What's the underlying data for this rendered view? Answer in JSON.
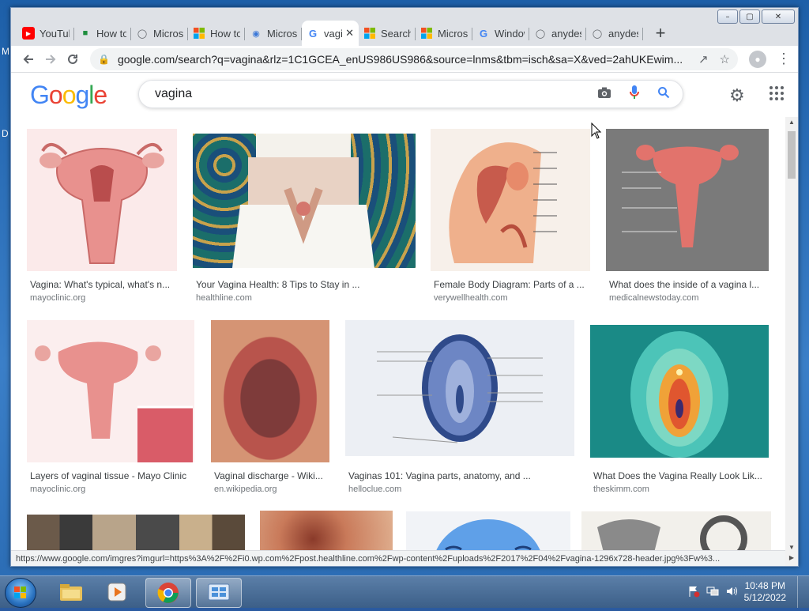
{
  "desktop": {
    "marks": [
      "M",
      "D"
    ]
  },
  "window": {
    "min_glyph": "–",
    "max_glyph": "▢",
    "close_glyph": "✕"
  },
  "tabs": [
    {
      "title": "YouTube",
      "icon": "youtube-icon",
      "color": "#ff0000"
    },
    {
      "title": "How to",
      "icon": "doc-person-icon",
      "color": "#1e8e3e"
    },
    {
      "title": "Microsoft",
      "icon": "globe-icon",
      "color": "#5f6368"
    },
    {
      "title": "How to",
      "icon": "microsoft-icon",
      "color": "#f25022"
    },
    {
      "title": "Microsoft",
      "icon": "edge-globe-icon",
      "color": "#3b78d8"
    },
    {
      "title": "vagina",
      "icon": "google-g-icon",
      "color": "#4285f4",
      "active": true
    },
    {
      "title": "Search",
      "icon": "microsoft-icon",
      "color": "#f25022"
    },
    {
      "title": "Microsoft",
      "icon": "microsoft-icon",
      "color": "#f25022"
    },
    {
      "title": "Windows",
      "icon": "google-g-icon",
      "color": "#4285f4"
    },
    {
      "title": "anydesk",
      "icon": "globe-icon",
      "color": "#5f6368"
    },
    {
      "title": "anydesk",
      "icon": "globe-icon",
      "color": "#5f6368"
    }
  ],
  "toolbar": {
    "url": "google.com/search?q=vagina&rlz=1C1GCEA_enUS986US986&source=lnms&tbm=isch&sa=X&ved=2ahUKEwim..."
  },
  "google": {
    "logo_letters": [
      {
        "ch": "G",
        "color": "#4285f4"
      },
      {
        "ch": "o",
        "color": "#ea4335"
      },
      {
        "ch": "o",
        "color": "#fbbc05"
      },
      {
        "ch": "g",
        "color": "#4285f4"
      },
      {
        "ch": "l",
        "color": "#34a853"
      },
      {
        "ch": "e",
        "color": "#ea4335"
      }
    ],
    "query": "vagina"
  },
  "results": [
    {
      "caption": "Vagina: What's typical, what's n...",
      "source": "mayoclinic.org"
    },
    {
      "caption": "Your Vagina Health: 8 Tips to Stay in ...",
      "source": "healthline.com"
    },
    {
      "caption": "Female Body Diagram: Parts of a ...",
      "source": "verywellhealth.com"
    },
    {
      "caption": "What does the inside of a vagina l...",
      "source": "medicalnewstoday.com"
    },
    {
      "caption": "Layers of vaginal tissue - Mayo Clinic",
      "source": "mayoclinic.org"
    },
    {
      "caption": "Vaginal discharge - Wiki...",
      "source": "en.wikipedia.org"
    },
    {
      "caption": "Vaginas 101: Vagina parts, anatomy, and ...",
      "source": "helloclue.com"
    },
    {
      "caption": "What Does the Vagina Really Look Lik...",
      "source": "theskimm.com"
    }
  ],
  "statusbar": {
    "link": "https://www.google.com/imgres?imgurl=https%3A%2F%2Fi0.wp.com%2Fpost.healthline.com%2Fwp-content%2Fuploads%2F2017%2F04%2Fvagina-1296x728-header.jpg%3Fw%3..."
  },
  "taskbar": {
    "time": "10:48 PM",
    "date": "5/12/2022"
  }
}
